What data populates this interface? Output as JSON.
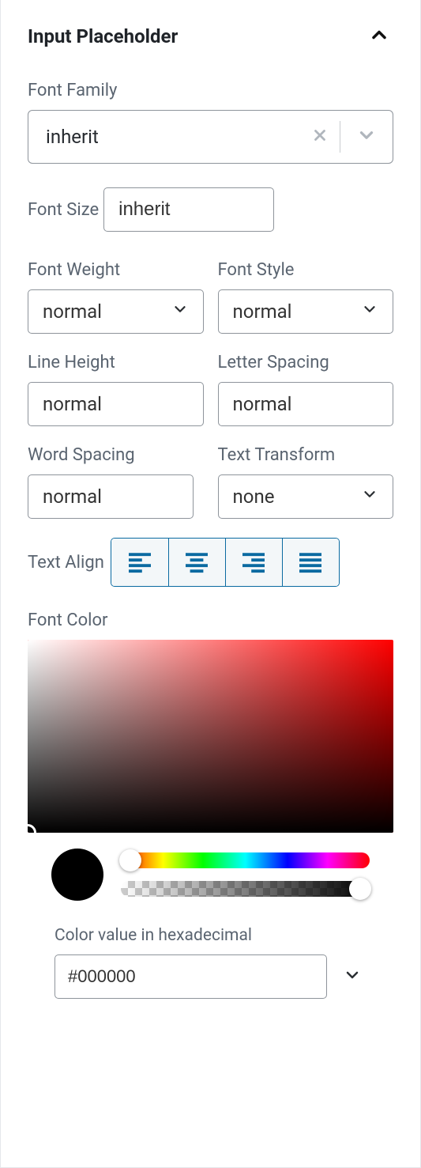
{
  "section": {
    "title": "Input Placeholder"
  },
  "fontFamily": {
    "label": "Font Family",
    "value": "inherit"
  },
  "fontSize": {
    "label": "Font Size",
    "value": "inherit"
  },
  "fontWeight": {
    "label": "Font Weight",
    "value": "normal"
  },
  "fontStyle": {
    "label": "Font Style",
    "value": "normal"
  },
  "lineHeight": {
    "label": "Line Height",
    "value": "normal"
  },
  "letterSpacing": {
    "label": "Letter Spacing",
    "value": "normal"
  },
  "wordSpacing": {
    "label": "Word Spacing",
    "value": "normal"
  },
  "textTransform": {
    "label": "Text Transform",
    "value": "none"
  },
  "textAlign": {
    "label": "Text Align"
  },
  "fontColor": {
    "label": "Font Color",
    "swatch": "#000000",
    "hexLabel": "Color value in hexadecimal",
    "hexValue": "#000000"
  }
}
